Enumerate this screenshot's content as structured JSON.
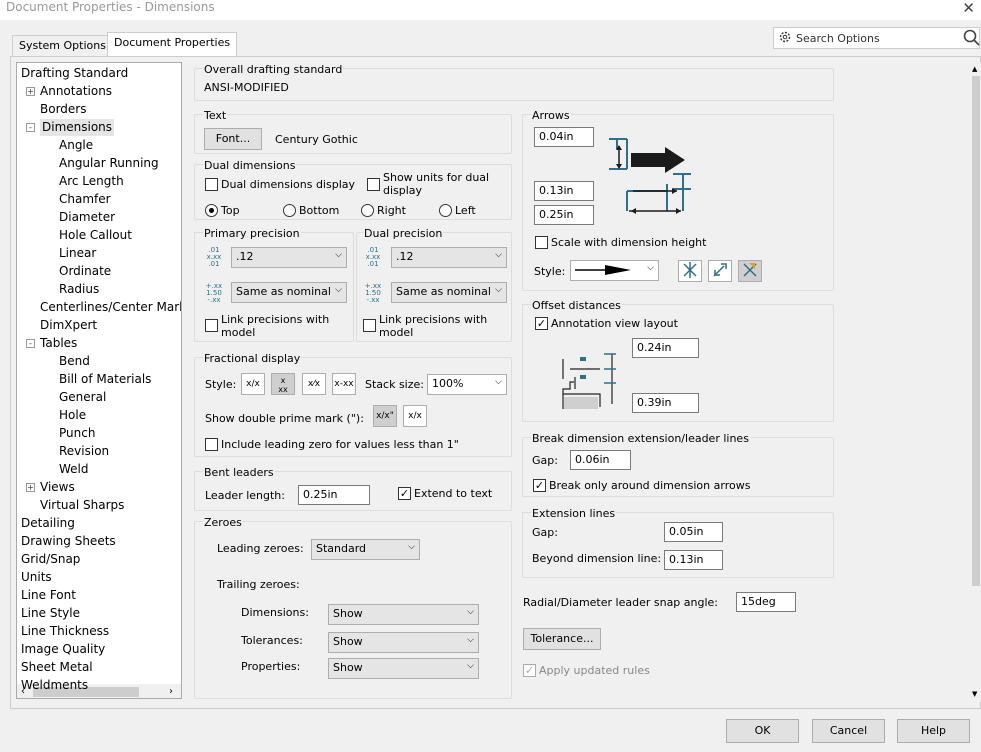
{
  "window": {
    "title": "Document Properties - Dimensions"
  },
  "tabs": [
    {
      "label": "System Options"
    },
    {
      "label": "Document Properties"
    }
  ],
  "search": {
    "placeholder": "Search Options"
  },
  "tree": [
    {
      "label": "Drafting Standard",
      "indent": 0
    },
    {
      "label": "Annotations",
      "indent": 1,
      "expander": "+"
    },
    {
      "label": "Borders",
      "indent": 1
    },
    {
      "label": "Dimensions",
      "indent": 1,
      "expander": "-",
      "selected": true
    },
    {
      "label": "Angle",
      "indent": 2
    },
    {
      "label": "Angular Running",
      "indent": 2
    },
    {
      "label": "Arc Length",
      "indent": 2
    },
    {
      "label": "Chamfer",
      "indent": 2
    },
    {
      "label": "Diameter",
      "indent": 2
    },
    {
      "label": "Hole Callout",
      "indent": 2
    },
    {
      "label": "Linear",
      "indent": 2
    },
    {
      "label": "Ordinate",
      "indent": 2
    },
    {
      "label": "Radius",
      "indent": 2
    },
    {
      "label": "Centerlines/Center Marl",
      "indent": 1
    },
    {
      "label": "DimXpert",
      "indent": 1
    },
    {
      "label": "Tables",
      "indent": 1,
      "expander": "-"
    },
    {
      "label": "Bend",
      "indent": 2
    },
    {
      "label": "Bill of Materials",
      "indent": 2
    },
    {
      "label": "General",
      "indent": 2
    },
    {
      "label": "Hole",
      "indent": 2
    },
    {
      "label": "Punch",
      "indent": 2
    },
    {
      "label": "Revision",
      "indent": 2
    },
    {
      "label": "Weld",
      "indent": 2
    },
    {
      "label": "Views",
      "indent": 1,
      "expander": "+"
    },
    {
      "label": "Virtual Sharps",
      "indent": 1
    },
    {
      "label": "Detailing",
      "indent": 0
    },
    {
      "label": "Drawing Sheets",
      "indent": 0
    },
    {
      "label": "Grid/Snap",
      "indent": 0
    },
    {
      "label": "Units",
      "indent": 0
    },
    {
      "label": "Line Font",
      "indent": 0
    },
    {
      "label": "Line Style",
      "indent": 0
    },
    {
      "label": "Line Thickness",
      "indent": 0
    },
    {
      "label": "Image Quality",
      "indent": 0
    },
    {
      "label": "Sheet Metal",
      "indent": 0
    },
    {
      "label": "Weldments",
      "indent": 0
    }
  ],
  "overall": {
    "title": "Overall drafting standard",
    "value": "ANSI-MODIFIED"
  },
  "text": {
    "title": "Text",
    "font_button": "Font...",
    "font_name": "Century Gothic"
  },
  "dual": {
    "title": "Dual dimensions",
    "display": "Dual dimensions display",
    "show_units": "Show units for dual display",
    "top": "Top",
    "bottom": "Bottom",
    "right": "Right",
    "left": "Left"
  },
  "primary": {
    "title": "Primary precision",
    "value": ".12",
    "tol": "Same as nominal",
    "link": "Link precisions with model"
  },
  "dualprec": {
    "title": "Dual precision",
    "value": ".12",
    "tol": "Same as nominal",
    "link": "Link precisions with model"
  },
  "fractional": {
    "title": "Fractional display",
    "style": "Style:",
    "stack_label": "Stack size:",
    "stack": "100%",
    "double_prime": "Show double prime mark (\"):",
    "leading_zero": "Include leading zero for values less than 1\""
  },
  "bent": {
    "title": "Bent leaders",
    "leader_label": "Leader length:",
    "leader": "0.25in",
    "extend": "Extend to text"
  },
  "zeroes": {
    "title": "Zeroes",
    "leading_label": "Leading zeroes:",
    "leading": "Standard",
    "trailing_label": "Trailing zeroes:",
    "dims_label": "Dimensions:",
    "dims": "Show",
    "tols_label": "Tolerances:",
    "tols": "Show",
    "props_label": "Properties:",
    "props": "Show"
  },
  "arrows": {
    "title": "Arrows",
    "v1": "0.04in",
    "v2": "0.13in",
    "v3": "0.25in",
    "scale": "Scale with dimension height",
    "style_label": "Style:"
  },
  "offset": {
    "title": "Offset distances",
    "annotation": "Annotation view layout",
    "v1": "0.24in",
    "v2": "0.39in"
  },
  "break": {
    "title": "Break dimension extension/leader lines",
    "gap_label": "Gap:",
    "gap": "0.06in",
    "only": "Break only around dimension arrows"
  },
  "ext": {
    "title": "Extension lines",
    "gap_label": "Gap:",
    "gap": "0.05in",
    "beyond_label": "Beyond dimension line:",
    "beyond": "0.13in"
  },
  "radial": {
    "label": "Radial/Diameter leader snap angle:",
    "value": "15deg"
  },
  "tolerance_button": "Tolerance...",
  "apply_updated": "Apply updated rules",
  "footer": {
    "ok": "OK",
    "cancel": "Cancel",
    "help": "Help"
  },
  "colors": {
    "diagram_teal": "#2f6f8a",
    "arrow_dark": "#1a1a1a"
  }
}
